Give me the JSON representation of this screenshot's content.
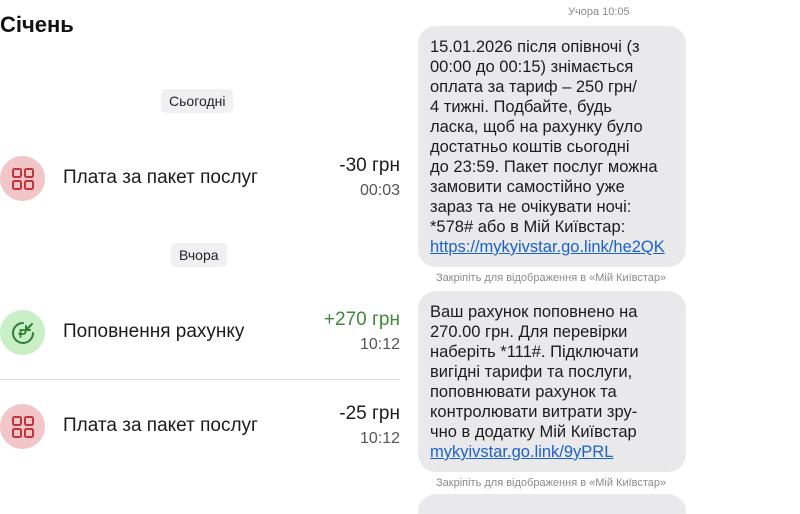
{
  "left": {
    "month": "Січень",
    "groups": [
      {
        "label": "Сьогодні",
        "items": [
          {
            "icon": "grid-icon",
            "title": "Плата за пакет послуг",
            "amount": "-30 грн",
            "time": "00:03",
            "kind": "debit"
          }
        ]
      },
      {
        "label": "Вчора",
        "items": [
          {
            "icon": "topup-icon",
            "title": "Поповнення рахунку",
            "amount": "+270 грн",
            "time": "10:12",
            "kind": "credit"
          },
          {
            "icon": "grid-icon",
            "title": "Плата за пакет послуг",
            "amount": "-25 грн",
            "time": "10:12",
            "kind": "debit"
          }
        ]
      }
    ]
  },
  "right": {
    "timestamp": "Учора 10:05",
    "messages": [
      {
        "text": "15.01.2026 після опівночі (з\n00:00 до 00:15) знімається\nоплата за тариф – 250 грн/\n4 тижні. Подбайте, будь\nласка, щоб на рахунку було\nдостатньо коштів сьогодні\nдо 23:59. Пакет послуг можна\nзамовити самостійно уже\nзараз та не очікувати ночі:\n*578# або в Мій Київстар:",
        "link": "https://mykyivstar.go.link/he2QK",
        "caption": "Закріпіть для відображення в «Мій Київстар»"
      },
      {
        "text": "Ваш рахунок поповнено на\n270.00 грн. Для перевірки\nнаберіть *111#. Підключати\nвигідні тарифи та послуги,\nпоповнювати рахунок та\nконтролювати витрати зру-\nчно в додатку Мій Київстар",
        "link": "mykyivstar.go.link/9yPRL",
        "caption": "Закріпіть для відображення в «Мій Київстар»"
      }
    ]
  },
  "colors": {
    "debit_icon_bg": "#f2c5c8",
    "debit_icon_fg": "#c0353c",
    "credit_icon_bg": "#c9efc7",
    "credit_icon_fg": "#2e7d32",
    "credit_amount": "#3f8a3a",
    "link": "#1a62c9",
    "bubble_bg": "#e9e9eb"
  }
}
